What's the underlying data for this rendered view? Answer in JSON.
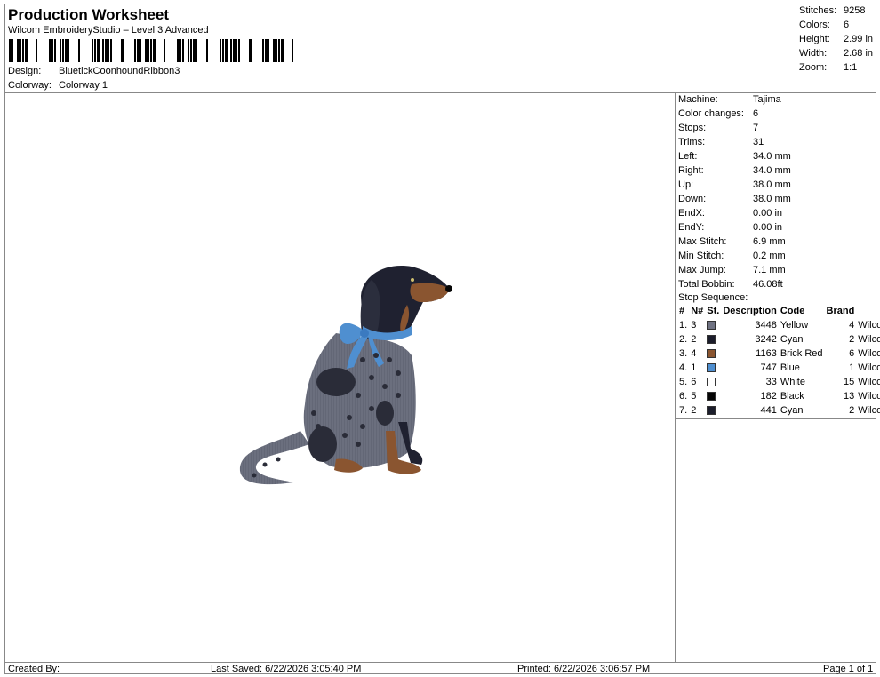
{
  "header": {
    "title": "Production Worksheet",
    "subtitle": "Wilcom EmbroideryStudio – Level 3 Advanced",
    "design_label": "Design:",
    "design_value": "BluetickCoonhoundRibbon3",
    "colorway_label": "Colorway:",
    "colorway_value": "Colorway 1"
  },
  "summary": [
    {
      "label": "Stitches:",
      "value": "9258"
    },
    {
      "label": "Colors:",
      "value": "6"
    },
    {
      "label": "Height:",
      "value": "2.99 in"
    },
    {
      "label": "Width:",
      "value": "2.68 in"
    },
    {
      "label": "Zoom:",
      "value": "1:1"
    }
  ],
  "machine_info": [
    {
      "label": "Machine:",
      "value": "Tajima"
    },
    {
      "label": "Color changes:",
      "value": "6"
    },
    {
      "label": "Stops:",
      "value": "7"
    },
    {
      "label": "Trims:",
      "value": "31"
    },
    {
      "label": "Left:",
      "value": "34.0 mm"
    },
    {
      "label": "Right:",
      "value": "34.0 mm"
    },
    {
      "label": "Up:",
      "value": "38.0 mm"
    },
    {
      "label": "Down:",
      "value": "38.0 mm"
    },
    {
      "label": "EndX:",
      "value": "0.00 in"
    },
    {
      "label": "EndY:",
      "value": "0.00 in"
    },
    {
      "label": "Max Stitch:",
      "value": "6.9 mm"
    },
    {
      "label": "Min Stitch:",
      "value": "0.2 mm"
    },
    {
      "label": "Max Jump:",
      "value": "7.1 mm"
    },
    {
      "label": "Total Bobbin:",
      "value": "46.08ft"
    }
  ],
  "stop_sequence": {
    "title": "Stop Sequence:",
    "headers": {
      "num": "#",
      "n": "N#",
      "st": "St.",
      "desc": "Description",
      "code": "Code",
      "brand": "Brand"
    },
    "rows": [
      {
        "num": "1.",
        "n": "3",
        "color": "#6f7282",
        "st": "3448",
        "desc": "Yellow",
        "code": "4",
        "brand": "Wilcom"
      },
      {
        "num": "2.",
        "n": "2",
        "color": "#1b1d2b",
        "st": "3242",
        "desc": "Cyan",
        "code": "2",
        "brand": "Wilcom"
      },
      {
        "num": "3.",
        "n": "4",
        "color": "#8a5530",
        "st": "1163",
        "desc": "Brick Red",
        "code": "6",
        "brand": "Wilcom"
      },
      {
        "num": "4.",
        "n": "1",
        "color": "#4f8fd0",
        "st": "747",
        "desc": "Blue",
        "code": "1",
        "brand": "Wilcom"
      },
      {
        "num": "5.",
        "n": "6",
        "color": "#ffffff",
        "st": "33",
        "desc": "White",
        "code": "15",
        "brand": "Wilcom"
      },
      {
        "num": "6.",
        "n": "5",
        "color": "#050505",
        "st": "182",
        "desc": "Black",
        "code": "13",
        "brand": "Wilcom"
      },
      {
        "num": "7.",
        "n": "2",
        "color": "#1b1d2b",
        "st": "441",
        "desc": "Cyan",
        "code": "2",
        "brand": "Wilcom"
      }
    ]
  },
  "footer": {
    "created_by": "Created By:",
    "last_saved": "Last Saved: 6/22/2026 3:05:40 PM",
    "printed": "Printed: 6/22/2026 3:06:57 PM",
    "page": "Page 1 of 1"
  }
}
